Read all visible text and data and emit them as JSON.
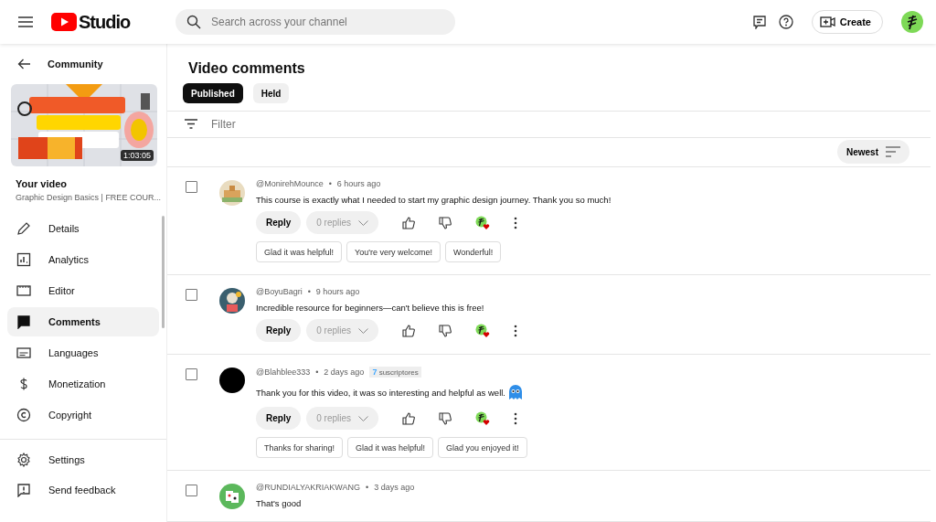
{
  "header": {
    "logo_text": "Studio",
    "search": {
      "placeholder": "Search across your channel"
    },
    "create_label": "Create"
  },
  "sidebar": {
    "back_label": "Community",
    "video": {
      "duration": "1:03:05",
      "heading": "Your video",
      "title": "Graphic Design Basics | FREE COUR..."
    },
    "items": [
      {
        "label": "Details",
        "selected": false
      },
      {
        "label": "Analytics",
        "selected": false
      },
      {
        "label": "Editor",
        "selected": false
      },
      {
        "label": "Comments",
        "selected": true
      },
      {
        "label": "Languages",
        "selected": false
      },
      {
        "label": "Monetization",
        "selected": false
      },
      {
        "label": "Copyright",
        "selected": false
      }
    ],
    "footer_items": [
      {
        "label": "Settings"
      },
      {
        "label": "Send feedback"
      }
    ]
  },
  "main": {
    "title": "Video comments",
    "tabs": [
      {
        "label": "Published",
        "selected": true
      },
      {
        "label": "Held",
        "selected": false
      }
    ],
    "filter": {
      "placeholder": "Filter"
    },
    "sort_label": "Newest",
    "comments": [
      {
        "author": "@MonirehMounce",
        "separator": "•",
        "time": "6 hours ago",
        "text": "This course is exactly what I needed to start my graphic design journey. Thank you so much!",
        "emoji": false,
        "checked": false,
        "reply_label": "Reply",
        "replies_label": "0 replies",
        "hearted": true,
        "suggestions": [
          "Glad it was helpful!",
          "You're very welcome!",
          "Wonderful!"
        ]
      },
      {
        "author": "@BoyuBagri",
        "separator": "•",
        "time": "9 hours ago",
        "text": "Incredible resource for beginners—can't believe this is free!",
        "emoji": false,
        "checked": false,
        "reply_label": "Reply",
        "replies_label": "0 replies",
        "hearted": true
      },
      {
        "author": "@Blahblee333",
        "separator": "•",
        "time": "2 days ago",
        "badge": {
          "count": "7",
          "label": "suscriptores"
        },
        "text": "Thank you for this video, it was so interesting and helpful as well.",
        "emoji": true,
        "checked": false,
        "reply_label": "Reply",
        "replies_label": "0 replies",
        "hearted": true,
        "suggestions": [
          "Thanks for sharing!",
          "Glad it was helpful!",
          "Glad you enjoyed it!"
        ]
      },
      {
        "author": "@RUNDIALYAKRIAKWANG",
        "separator": "•",
        "time": "3 days ago",
        "text": "That's good",
        "emoji": false,
        "checked": false
      }
    ]
  }
}
